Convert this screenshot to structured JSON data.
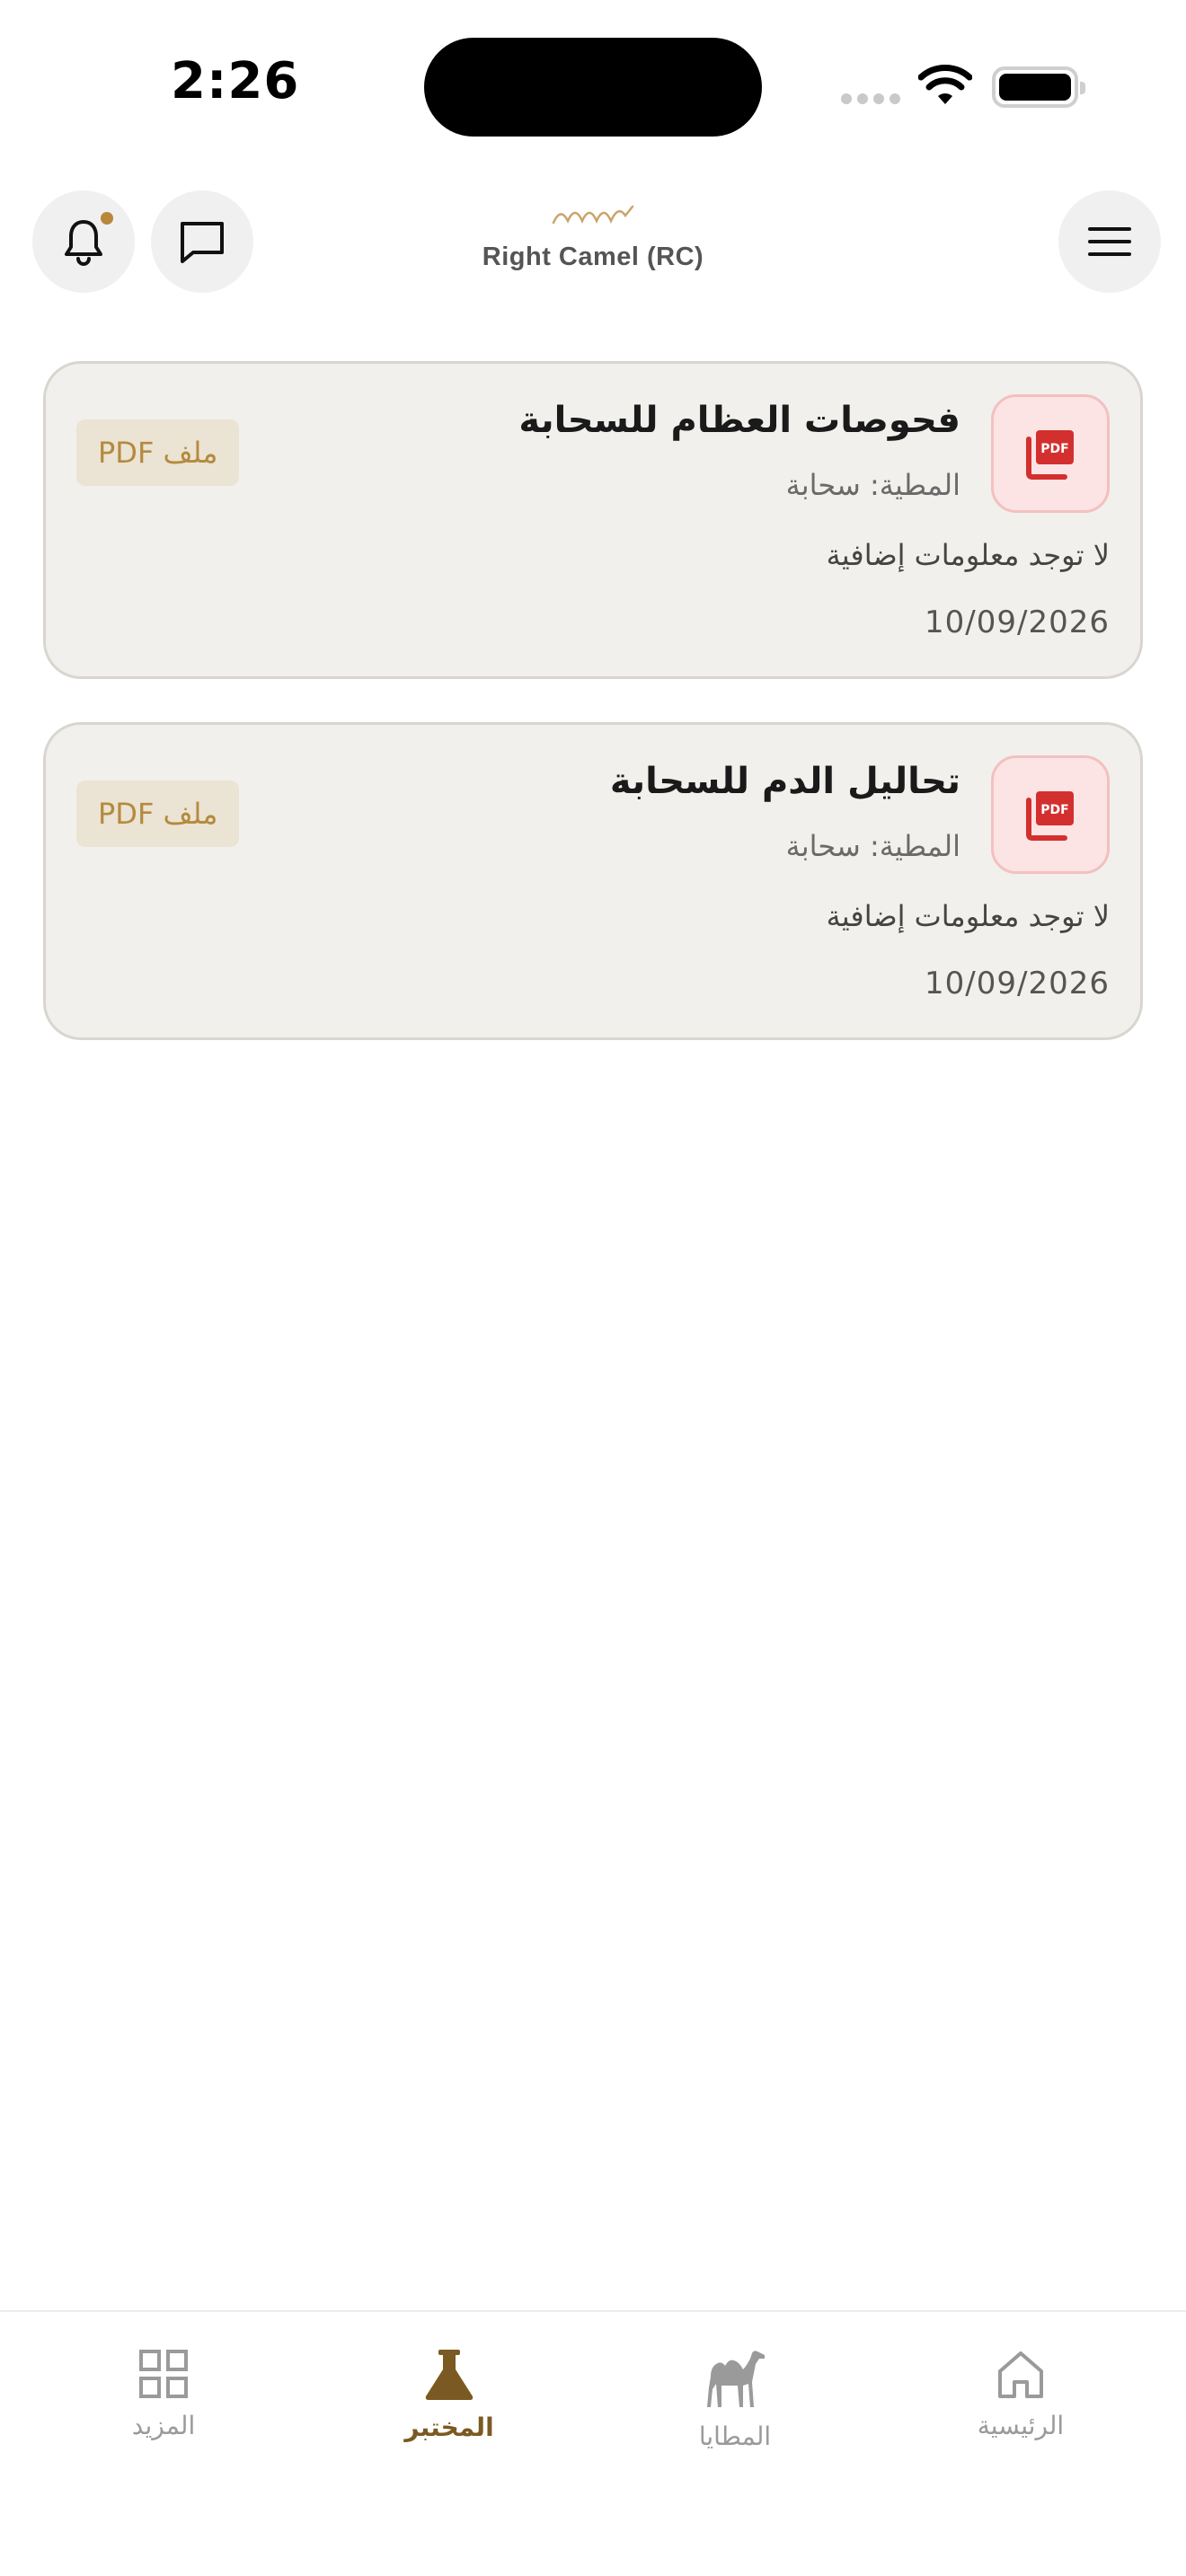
{
  "status_bar": {
    "time": "2:26"
  },
  "header": {
    "logo_text": "Right Camel (RC)"
  },
  "colors": {
    "accent": "#7a5a22",
    "badge_text": "#b48a3e",
    "badge_bg": "#ebe3d3",
    "card_bg": "#f1f0ec",
    "pdf_red": "#d32f2f",
    "notification_dot": "#b8873c"
  },
  "reports": [
    {
      "title": "فحوصات العظام للسحابة",
      "subtitle": "المطية: سحابة",
      "description": "لا توجد معلومات إضافية",
      "date": "10/09/2026",
      "badge": "ملف PDF",
      "icon": "pdf-icon"
    },
    {
      "title": "تحاليل الدم للسحابة",
      "subtitle": "المطية: سحابة",
      "description": "لا توجد معلومات إضافية",
      "date": "10/09/2026",
      "badge": "ملف PDF",
      "icon": "pdf-icon"
    }
  ],
  "bottom_nav": [
    {
      "label": "المزيد",
      "icon": "grid-icon",
      "active": false
    },
    {
      "label": "المختبر",
      "icon": "flask-icon",
      "active": true
    },
    {
      "label": "المطايا",
      "icon": "camel-icon",
      "active": false
    },
    {
      "label": "الرئيسية",
      "icon": "home-icon",
      "active": false
    }
  ]
}
